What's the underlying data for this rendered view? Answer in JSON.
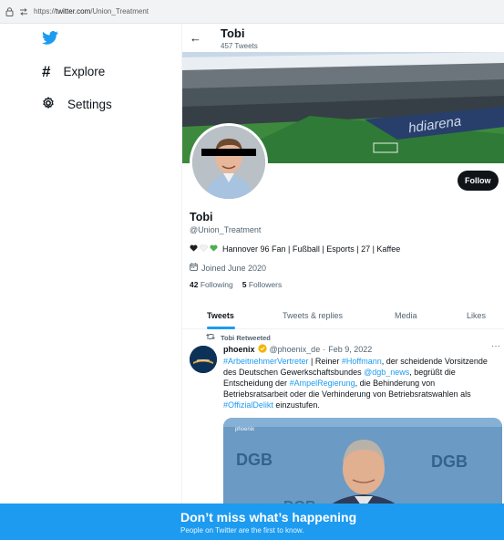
{
  "browser": {
    "url_prefix": "https://",
    "url_domain": "twitter.com",
    "url_path": "/Union_Treatment"
  },
  "nav": {
    "explore_label": "Explore",
    "settings_label": "Settings"
  },
  "header": {
    "title": "Tobi",
    "tweet_count": "457 Tweets",
    "back_icon": "←"
  },
  "profile": {
    "name": "Tobi",
    "handle": "@Union_Treatment",
    "bio": "Hannover 96 Fan | Fußball | Esports | 27 | Kaffee",
    "joined": "Joined June 2020",
    "following_count": "42",
    "following_label": "Following",
    "followers_count": "5",
    "followers_label": "Followers",
    "follow_button": "Follow"
  },
  "tabs": [
    {
      "label": "Tweets",
      "active": true
    },
    {
      "label": "Tweets & replies",
      "active": false
    },
    {
      "label": "Media",
      "active": false
    },
    {
      "label": "Likes",
      "active": false
    }
  ],
  "tweet": {
    "retweet_label": "Tobi Retweeted",
    "author_name": "phoenix",
    "author_handle": "@phoenix_de",
    "separator": "·",
    "date": "Feb 9, 2022",
    "more_icon": "···",
    "text_parts": [
      {
        "t": "#ArbeitnehmerVertreter",
        "link": true
      },
      {
        "t": " | Reiner ",
        "link": false
      },
      {
        "t": "#Hoffmann",
        "link": true
      },
      {
        "t": ", der scheidende Vorsitzende des Deutschen Gewerkschaftsbundes ",
        "link": false
      },
      {
        "t": "@dgb_news",
        "link": true
      },
      {
        "t": ", begrüßt die Entscheidung der ",
        "link": false
      },
      {
        "t": "#AmpelRegierung",
        "link": true
      },
      {
        "t": ", die Behinderung von Betriebsratsarbeit oder die Verhinderung von Betriebsratswahlen als ",
        "link": false
      },
      {
        "t": "#OffizialDelikt",
        "link": true
      },
      {
        "t": " einzustufen.",
        "link": false
      }
    ],
    "media_logo": "phoenix",
    "media_text_a": "DGB",
    "media_text_b": "DGB",
    "media_text_c": "DGB"
  },
  "banner_overlay": {
    "arena_text": "hdiarena"
  },
  "bottom_bar": {
    "title": "Don’t miss what’s happening",
    "subtitle": "People on Twitter are the first to know."
  },
  "colors": {
    "accent": "#1d9bf0",
    "text": "#0f1419",
    "muted": "#536471",
    "verified": "#f4b400"
  },
  "icons": [
    "lock-icon",
    "tracking-icon",
    "twitter-bird-icon",
    "hashtag-icon",
    "gear-icon",
    "back-arrow-icon",
    "calendar-icon",
    "retweet-icon",
    "verified-badge-icon",
    "more-icon",
    "heart-icon"
  ]
}
